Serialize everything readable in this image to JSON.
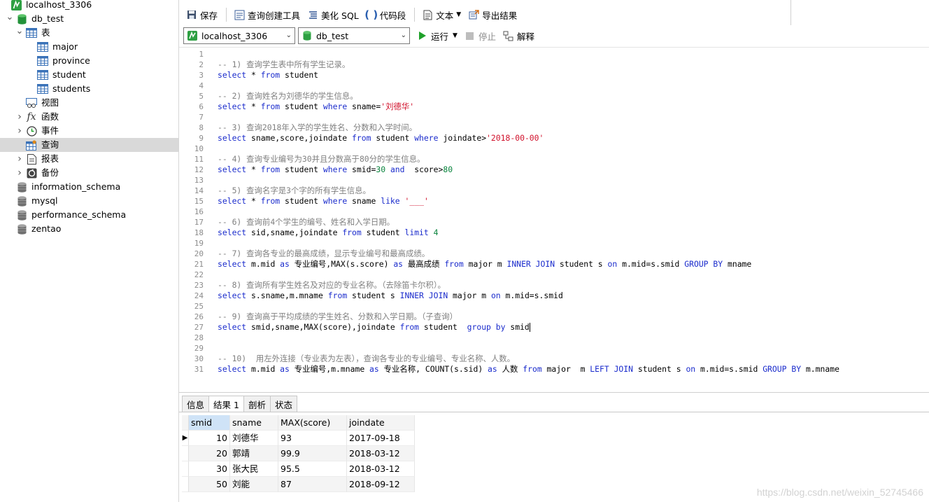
{
  "sidebar": {
    "items": [
      {
        "label": "localhost_3306",
        "icon": "mysql-connection-icon",
        "level": 0,
        "twisty": "",
        "selected": false
      },
      {
        "label": "db_test",
        "icon": "database-icon",
        "level": 1,
        "twisty": "open",
        "selected": false
      },
      {
        "label": "表",
        "icon": "table-folder-icon",
        "level": 2,
        "twisty": "open",
        "selected": false
      },
      {
        "label": "major",
        "icon": "table-icon",
        "level": 3,
        "twisty": "",
        "selected": false
      },
      {
        "label": "province",
        "icon": "table-icon",
        "level": 3,
        "twisty": "",
        "selected": false
      },
      {
        "label": "student",
        "icon": "table-icon",
        "level": 3,
        "twisty": "",
        "selected": false
      },
      {
        "label": "students",
        "icon": "table-icon",
        "level": 3,
        "twisty": "",
        "selected": false
      },
      {
        "label": "视图",
        "icon": "view-icon",
        "level": 2,
        "twisty": "",
        "selected": false
      },
      {
        "label": "函数",
        "icon": "function-icon",
        "level": 2,
        "twisty": "closed",
        "selected": false
      },
      {
        "label": "事件",
        "icon": "event-clock-icon",
        "level": 2,
        "twisty": "closed",
        "selected": false
      },
      {
        "label": "查询",
        "icon": "query-icon",
        "level": 2,
        "twisty": "",
        "selected": true
      },
      {
        "label": "报表",
        "icon": "report-icon",
        "level": 2,
        "twisty": "closed",
        "selected": false
      },
      {
        "label": "备份",
        "icon": "backup-icon",
        "level": 2,
        "twisty": "closed",
        "selected": false
      },
      {
        "label": "information_schema",
        "icon": "database-gray-icon",
        "level": 1,
        "twisty": "",
        "selected": false
      },
      {
        "label": "mysql",
        "icon": "database-gray-icon",
        "level": 1,
        "twisty": "",
        "selected": false
      },
      {
        "label": "performance_schema",
        "icon": "database-gray-icon",
        "level": 1,
        "twisty": "",
        "selected": false
      },
      {
        "label": "zentao",
        "icon": "database-gray-icon",
        "level": 1,
        "twisty": "",
        "selected": false
      }
    ]
  },
  "toolbar1": {
    "save": "保存",
    "query_builder": "查询创建工具",
    "beautify": "美化 SQL",
    "snippet": "代码段",
    "text": "文本",
    "export": "导出结果"
  },
  "toolbar2": {
    "connection": "localhost_3306",
    "database": "db_test",
    "run": "运行",
    "stop": "停止",
    "explain": "解释"
  },
  "editor": {
    "lines": [
      [],
      [
        [
          "c",
          "-- 1) 查询学生表中所有学生记录。"
        ]
      ],
      [
        [
          "k",
          "select"
        ],
        [
          "p",
          " * "
        ],
        [
          "k",
          "from"
        ],
        [
          "p",
          " student"
        ]
      ],
      [],
      [
        [
          "c",
          "-- 2) 查询姓名为刘德华的学生信息。"
        ]
      ],
      [
        [
          "k",
          "select"
        ],
        [
          "p",
          " * "
        ],
        [
          "k",
          "from"
        ],
        [
          "p",
          " student "
        ],
        [
          "k",
          "where"
        ],
        [
          "p",
          " sname="
        ],
        [
          "s",
          "'刘德华'"
        ]
      ],
      [],
      [
        [
          "c",
          "-- 3) 查询2018年入学的学生姓名、分数和入学时间。"
        ]
      ],
      [
        [
          "k",
          "select"
        ],
        [
          "p",
          " sname,score,joindate "
        ],
        [
          "k",
          "from"
        ],
        [
          "p",
          " student "
        ],
        [
          "k",
          "where"
        ],
        [
          "p",
          " joindate>"
        ],
        [
          "s",
          "'2018-00-00'"
        ]
      ],
      [],
      [
        [
          "c",
          "-- 4) 查询专业编号为30并且分数高于80分的学生信息。"
        ]
      ],
      [
        [
          "k",
          "select"
        ],
        [
          "p",
          " * "
        ],
        [
          "k",
          "from"
        ],
        [
          "p",
          " student "
        ],
        [
          "k",
          "where"
        ],
        [
          "p",
          " smid="
        ],
        [
          "n",
          "30"
        ],
        [
          "p",
          " "
        ],
        [
          "k",
          "and"
        ],
        [
          "p",
          "  score>"
        ],
        [
          "n",
          "80"
        ]
      ],
      [],
      [
        [
          "c",
          "-- 5) 查询名字是3个字的所有学生信息。"
        ]
      ],
      [
        [
          "k",
          "select"
        ],
        [
          "p",
          " * "
        ],
        [
          "k",
          "from"
        ],
        [
          "p",
          " student "
        ],
        [
          "k",
          "where"
        ],
        [
          "p",
          " sname "
        ],
        [
          "k",
          "like"
        ],
        [
          "p",
          " "
        ],
        [
          "s",
          "'___'"
        ]
      ],
      [],
      [
        [
          "c",
          "-- 6) 查询前4个学生的编号、姓名和入学日期。"
        ]
      ],
      [
        [
          "k",
          "select"
        ],
        [
          "p",
          " sid,sname,joindate "
        ],
        [
          "k",
          "from"
        ],
        [
          "p",
          " student "
        ],
        [
          "k",
          "limit"
        ],
        [
          "p",
          " "
        ],
        [
          "n",
          "4"
        ]
      ],
      [],
      [
        [
          "c",
          "-- 7) 查询各专业的最高成绩，显示专业编号和最高成绩。"
        ]
      ],
      [
        [
          "k",
          "select"
        ],
        [
          "p",
          " m.mid "
        ],
        [
          "k",
          "as"
        ],
        [
          "p",
          " 专业编号,MAX(s.score) "
        ],
        [
          "k",
          "as"
        ],
        [
          "p",
          " 最高成绩 "
        ],
        [
          "k",
          "from"
        ],
        [
          "p",
          " major m "
        ],
        [
          "k",
          "INNER JOIN"
        ],
        [
          "p",
          " student s "
        ],
        [
          "k",
          "on"
        ],
        [
          "p",
          " m.mid=s.smid "
        ],
        [
          "k",
          "GROUP BY"
        ],
        [
          "p",
          " mname"
        ]
      ],
      [],
      [
        [
          "c",
          "-- 8) 查询所有学生姓名及对应的专业名称。（去除笛卡尔积）。"
        ]
      ],
      [
        [
          "k",
          "select"
        ],
        [
          "p",
          " s.sname,m.mname "
        ],
        [
          "k",
          "from"
        ],
        [
          "p",
          " student s "
        ],
        [
          "k",
          "INNER JOIN"
        ],
        [
          "p",
          " major m "
        ],
        [
          "k",
          "on"
        ],
        [
          "p",
          " m.mid=s.smid"
        ]
      ],
      [],
      [
        [
          "c",
          "-- 9) 查询高于平均成绩的学生姓名、分数和入学日期。（子查询）"
        ]
      ],
      [
        [
          "k",
          "select"
        ],
        [
          "p",
          " smid,sname,MAX(score),joindate "
        ],
        [
          "k",
          "from"
        ],
        [
          "p",
          " student  "
        ],
        [
          "k",
          "group by"
        ],
        [
          "p",
          " smid"
        ],
        [
          "cursor",
          ""
        ]
      ],
      [],
      [],
      [
        [
          "c",
          "-- 10)  用左外连接（专业表为左表），查询各专业的专业编号、专业名称、人数。"
        ]
      ],
      [
        [
          "k",
          "select"
        ],
        [
          "p",
          " m.mid "
        ],
        [
          "k",
          "as"
        ],
        [
          "p",
          " 专业编号,m.mname "
        ],
        [
          "k",
          "as"
        ],
        [
          "p",
          " 专业名称, COUNT(s.sid) "
        ],
        [
          "k",
          "as"
        ],
        [
          "p",
          " 人数 "
        ],
        [
          "k",
          "from"
        ],
        [
          "p",
          " major  m "
        ],
        [
          "k",
          "LEFT JOIN"
        ],
        [
          "p",
          " student s "
        ],
        [
          "k",
          "on"
        ],
        [
          "p",
          " m.mid=s.smid "
        ],
        [
          "k",
          "GROUP BY"
        ],
        [
          "p",
          " m.mname"
        ]
      ]
    ]
  },
  "result": {
    "tabs": [
      "信息",
      "结果 1",
      "剖析",
      "状态"
    ],
    "active_tab": 1,
    "columns": [
      "smid",
      "sname",
      "MAX(score)",
      "joindate"
    ],
    "rows": [
      [
        "10",
        "刘德华",
        "93",
        "2017-09-18"
      ],
      [
        "20",
        "郭靖",
        "99.9",
        "2018-03-12"
      ],
      [
        "30",
        "张大民",
        "95.5",
        "2018-03-12"
      ],
      [
        "50",
        "刘能",
        "87",
        "2018-09-12"
      ]
    ]
  },
  "watermark": "https://blog.csdn.net/weixin_52745466",
  "colors": {
    "keyword": "#1a2bcc",
    "comment": "#808080",
    "string": "#d0102a",
    "number": "#08833c",
    "run_green": "#1fa12a",
    "selected_row": "#d9d9d9"
  }
}
